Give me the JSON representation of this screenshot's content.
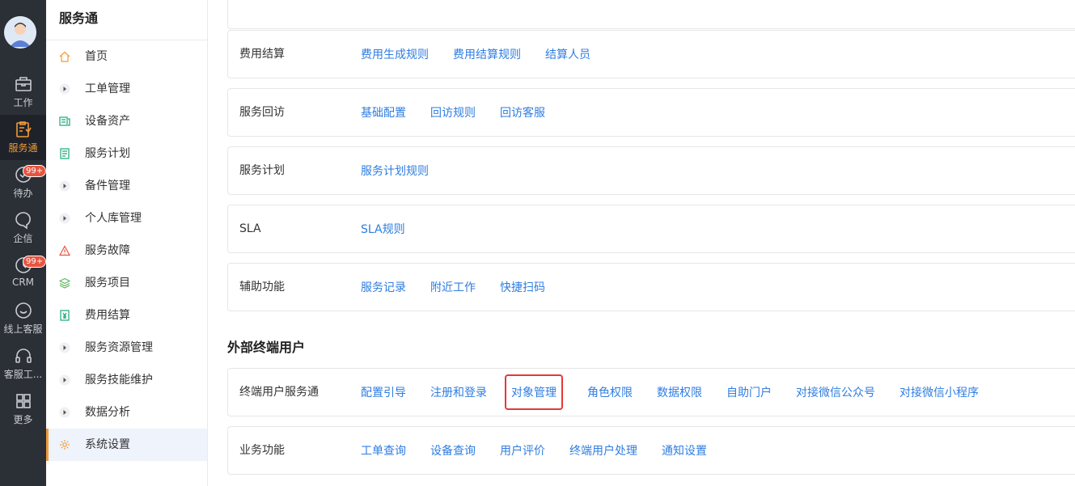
{
  "rail": {
    "items": [
      {
        "label": "工作",
        "icon": "briefcase-icon"
      },
      {
        "label": "服务通",
        "icon": "service-clipboard-icon"
      },
      {
        "label": "待办",
        "icon": "check-circle-icon",
        "badge": "99+"
      },
      {
        "label": "企信",
        "icon": "chat-bubble-icon"
      },
      {
        "label": "CRM",
        "icon": "clock-icon",
        "badge": "99+"
      },
      {
        "label": "线上客服",
        "icon": "smile-chat-icon"
      },
      {
        "label": "客服工...",
        "icon": "headset-icon"
      },
      {
        "label": "更多",
        "icon": "grid-icon"
      }
    ]
  },
  "menu": {
    "title": "服务通",
    "items": [
      {
        "label": "首页",
        "icon": "home-icon"
      },
      {
        "label": "工单管理",
        "icon": "expand-arrow-icon"
      },
      {
        "label": "设备资产",
        "icon": "asset-icon"
      },
      {
        "label": "服务计划",
        "icon": "plan-doc-icon"
      },
      {
        "label": "备件管理",
        "icon": "expand-arrow-icon"
      },
      {
        "label": "个人库管理",
        "icon": "expand-arrow-icon"
      },
      {
        "label": "服务故障",
        "icon": "warning-icon"
      },
      {
        "label": "服务项目",
        "icon": "layers-icon"
      },
      {
        "label": "费用结算",
        "icon": "yuan-doc-icon"
      },
      {
        "label": "服务资源管理",
        "icon": "expand-arrow-icon"
      },
      {
        "label": "服务技能维护",
        "icon": "expand-arrow-icon"
      },
      {
        "label": "数据分析",
        "icon": "expand-arrow-icon"
      },
      {
        "label": "系统设置",
        "icon": "gear-icon"
      }
    ]
  },
  "main": {
    "cards": [
      {
        "label": "费用结算",
        "links": [
          "费用生成规则",
          "费用结算规则",
          "结算人员"
        ]
      },
      {
        "label": "服务回访",
        "links": [
          "基础配置",
          "回访规则",
          "回访客服"
        ]
      },
      {
        "label": "服务计划",
        "links": [
          "服务计划规则"
        ]
      },
      {
        "label": "SLA",
        "links": [
          "SLA规则"
        ]
      },
      {
        "label": "辅助功能",
        "links": [
          "服务记录",
          "附近工作",
          "快捷扫码"
        ]
      }
    ],
    "section_title": "外部终端用户",
    "ext_cards": [
      {
        "label": "终端用户服务通",
        "links": [
          "配置引导",
          "注册和登录",
          "对象管理",
          "角色权限",
          "数据权限",
          "自助门户",
          "对接微信公众号",
          "对接微信小程序"
        ]
      },
      {
        "label": "业务功能",
        "links": [
          "工单查询",
          "设备查询",
          "用户评价",
          "终端用户处理",
          "通知设置"
        ]
      }
    ]
  }
}
